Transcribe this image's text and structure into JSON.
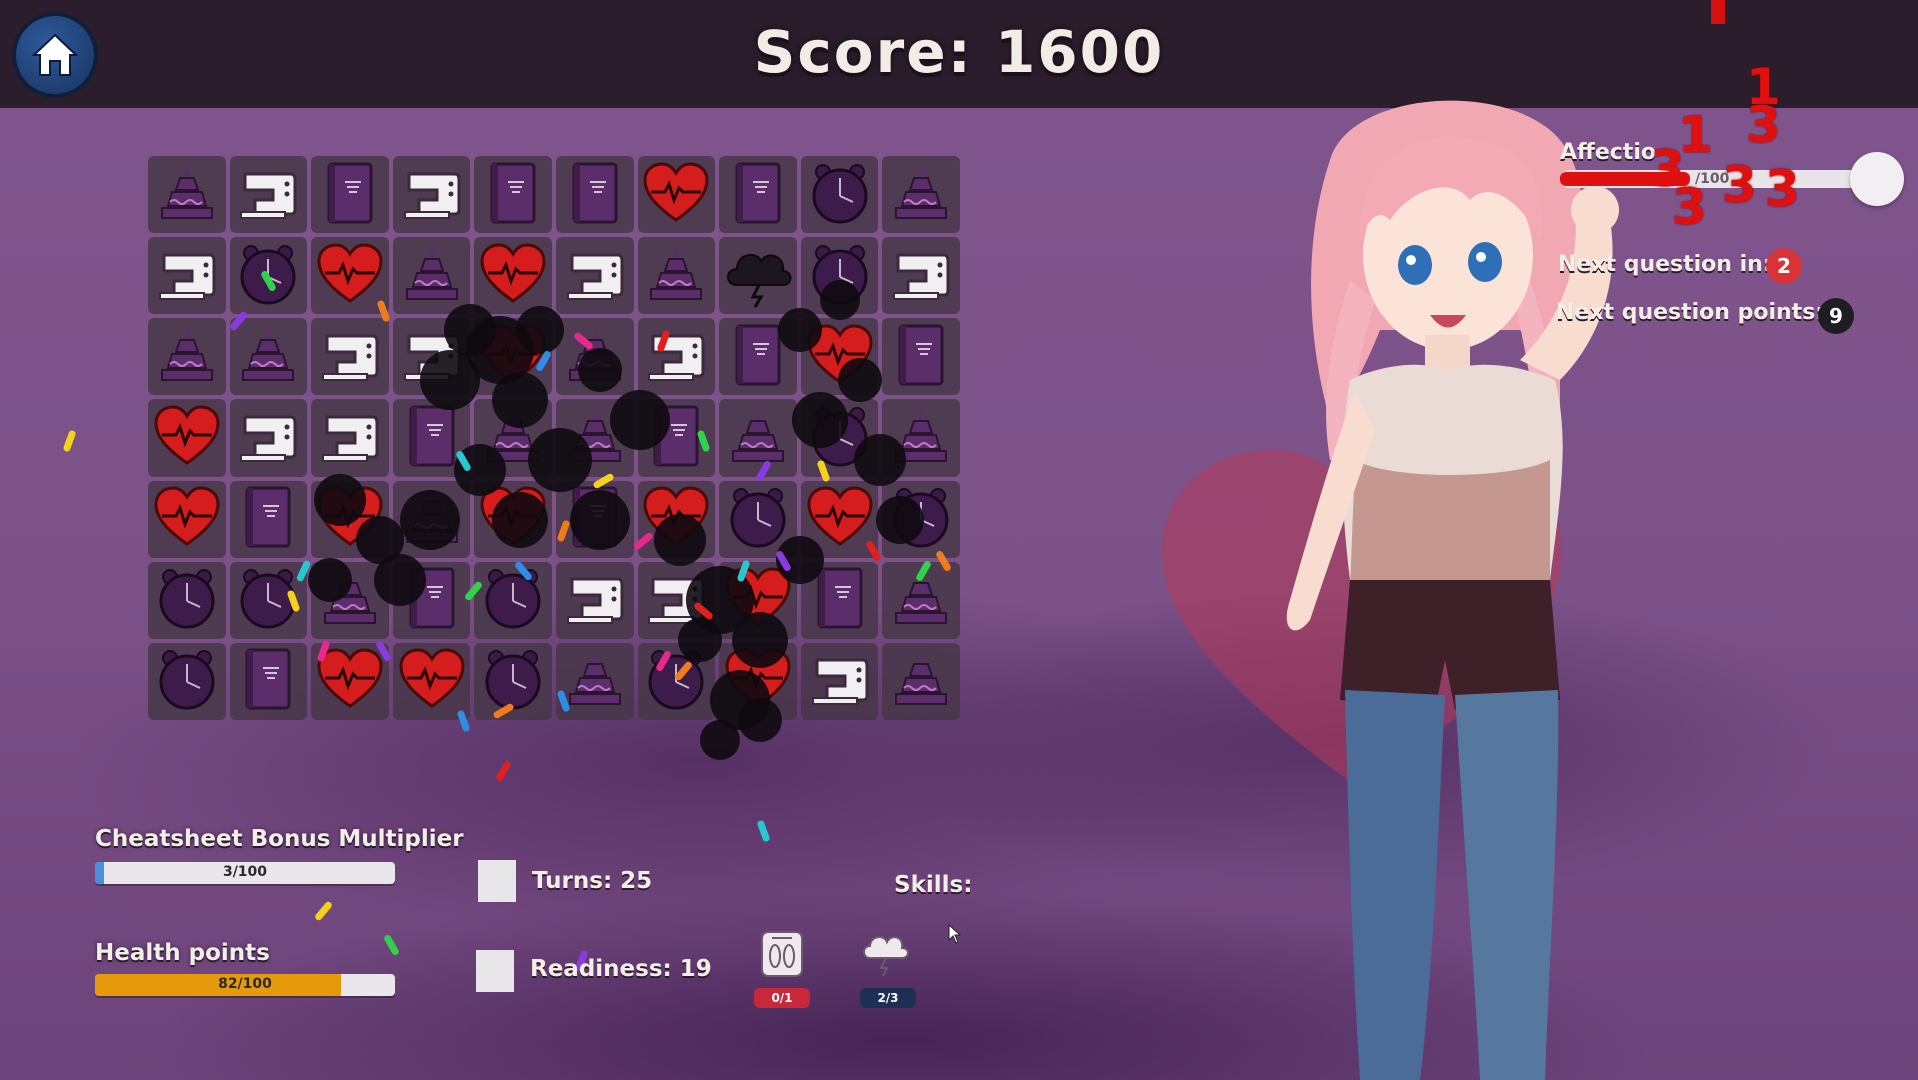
{
  "header": {
    "score_label": "Score",
    "score_value": "1600"
  },
  "board": {
    "rows": [
      [
        "cake",
        "machine",
        "book",
        "machine",
        "book",
        "book",
        "heart",
        "book",
        "clock",
        "cake"
      ],
      [
        "machine",
        "clock",
        "heart",
        "cake",
        "heart",
        "machine",
        "cake",
        "cloud",
        "clock",
        "machine"
      ],
      [
        "cake",
        "cake",
        "machine",
        "machine",
        "heart",
        "cake",
        "machine",
        "book",
        "heart",
        "book"
      ],
      [
        "heart",
        "machine",
        "machine",
        "book",
        "cake",
        "cake",
        "book",
        "cake",
        "clock",
        "cake"
      ],
      [
        "heart",
        "book",
        "heart",
        "cake",
        "heart",
        "book",
        "heart",
        "clock",
        "heart",
        "clock"
      ],
      [
        "clock",
        "clock",
        "cake",
        "book",
        "clock",
        "machine",
        "machine",
        "heart",
        "book",
        "cake"
      ],
      [
        "clock",
        "book",
        "heart",
        "heart",
        "clock",
        "cake",
        "clock",
        "heart",
        "machine",
        "cake"
      ]
    ]
  },
  "cheatsheet": {
    "title": "Cheatsheet Bonus Multiplier",
    "value_text": "3/100",
    "fraction": 0.03
  },
  "health": {
    "title": "Health points",
    "value_text": "82/100",
    "fraction": 0.82
  },
  "turns": {
    "label": "Turns",
    "value": "25"
  },
  "readiness": {
    "label": "Readiness",
    "value": "19"
  },
  "skills": {
    "title": "Skills:",
    "items": [
      {
        "icon": "foot-scale-icon",
        "badge": "0/1",
        "badge_color": "#c8283a"
      },
      {
        "icon": "storm-cloud-icon",
        "badge": "2/3",
        "badge_color": "#1e2f55"
      }
    ]
  },
  "affection": {
    "label": "Affectio",
    "value_text": "/100"
  },
  "next_question": {
    "label": "Next question in:",
    "value": "2"
  },
  "next_points": {
    "label": "Next question points:",
    "value": "9"
  },
  "damage_numbers": [
    "1",
    "3",
    "1",
    "3",
    "3",
    "3",
    "3"
  ],
  "colors": {
    "topbar": "#2c1d2c",
    "health_fill": "#e59a0c",
    "cheatsheet_fill": "#4a90d8",
    "icon_purple": "#5b2d6a",
    "heart_red": "#d51d1d",
    "damage_red": "#e01010"
  }
}
